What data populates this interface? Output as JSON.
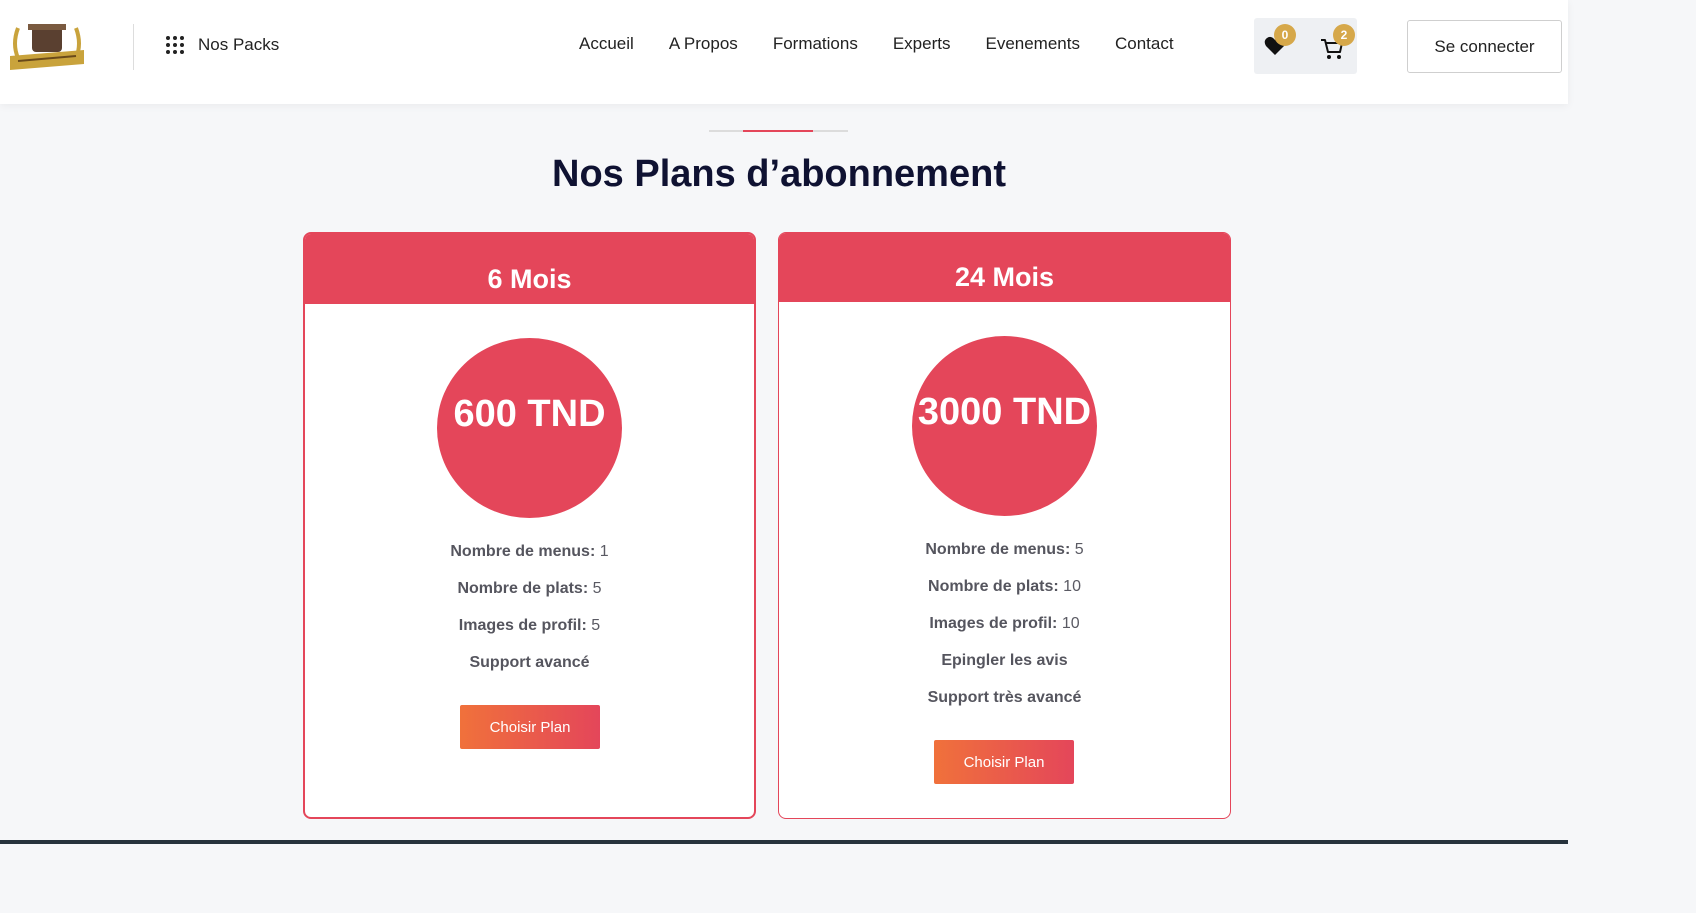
{
  "header": {
    "logo_alt": "couscous logo",
    "packs_label": "Nos Packs",
    "nav": [
      "Accueil",
      "A Propos",
      "Formations",
      "Experts",
      "Evenements",
      "Contact"
    ],
    "favorites_count": "0",
    "cart_count": "2",
    "login_label": "Se connecter"
  },
  "section": {
    "title": "Nos Plans d’abonnement"
  },
  "plans": [
    {
      "duration": "6 Mois",
      "price": "600 TND",
      "features": [
        {
          "label": "Nombre de menus:",
          "value": "1"
        },
        {
          "label": "Nombre de plats:",
          "value": "5"
        },
        {
          "label": "Images de profil:",
          "value": "5"
        },
        {
          "label": "Support avancé",
          "value": ""
        }
      ],
      "button": "Choisir Plan"
    },
    {
      "duration": "24 Mois",
      "price": "3000 TND",
      "features": [
        {
          "label": "Nombre de menus:",
          "value": "5"
        },
        {
          "label": "Nombre de plats:",
          "value": "10"
        },
        {
          "label": "Images de profil:",
          "value": "10"
        },
        {
          "label": "Epingler les avis",
          "value": ""
        },
        {
          "label": "Support très avancé",
          "value": ""
        }
      ],
      "button": "Choisir Plan"
    }
  ],
  "colors": {
    "accent": "#e4465a",
    "button_gradient_start": "#f0713b",
    "badge": "#d6a84a",
    "title": "#0f1232"
  }
}
